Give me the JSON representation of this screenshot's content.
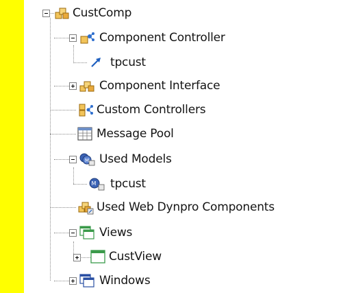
{
  "tree": {
    "root": {
      "label": "CustComp",
      "icon": "component-icon",
      "expanded": true
    },
    "items": [
      {
        "label": "Component Controller",
        "icon": "component-controller-icon",
        "expanded": true
      },
      {
        "label": "tpcust",
        "icon": "model-binding-arrow-icon"
      },
      {
        "label": "Component Interface",
        "icon": "component-interface-icon",
        "expanded": false
      },
      {
        "label": "Custom Controllers",
        "icon": "custom-controllers-icon"
      },
      {
        "label": "Message Pool",
        "icon": "message-pool-icon"
      },
      {
        "label": "Used Models",
        "icon": "used-models-icon",
        "expanded": true
      },
      {
        "label": "tpcust",
        "icon": "model-icon"
      },
      {
        "label": "Used Web Dynpro Components",
        "icon": "used-components-icon"
      },
      {
        "label": "Views",
        "icon": "views-icon",
        "expanded": true
      },
      {
        "label": "CustView",
        "icon": "view-icon",
        "expanded": false
      },
      {
        "label": "Windows",
        "icon": "windows-icon",
        "expanded": false
      }
    ]
  },
  "colors": {
    "highlight_bar": "#ffff00",
    "tree_line": "#8a8a8a",
    "text": "#141414"
  }
}
